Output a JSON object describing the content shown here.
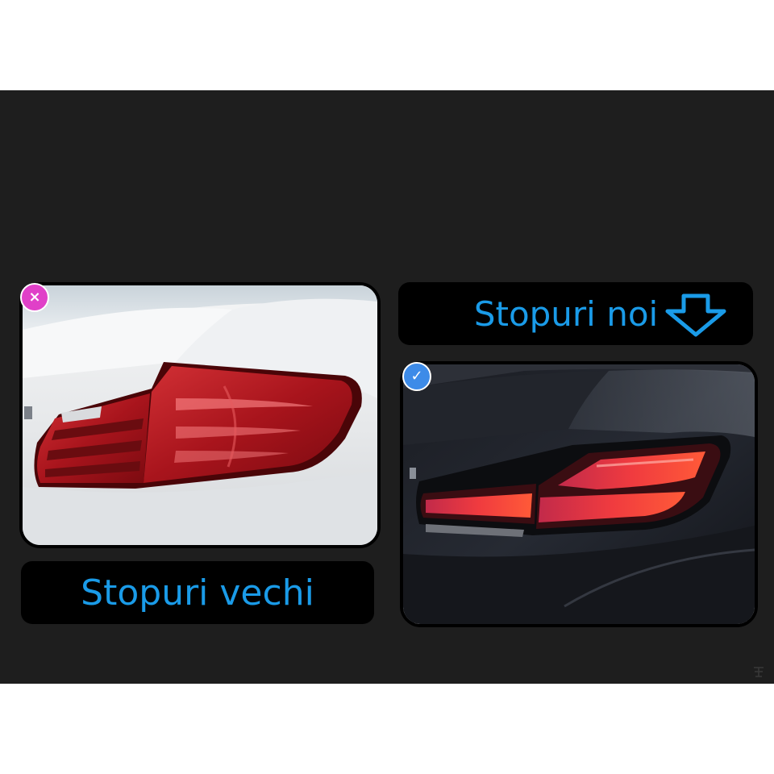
{
  "labels": {
    "old": "Stopuri vechi",
    "new": "Stopuri noi"
  },
  "badges": {
    "old_symbol": "×",
    "new_symbol": "✓"
  },
  "icons": [
    "close-icon",
    "check-icon",
    "down-arrow-icon"
  ],
  "colors": {
    "background": "#1e1e1e",
    "label_text": "#1a9be8",
    "label_box": "#000000",
    "badge_old": "#e040c8",
    "badge_new": "#3d8be8"
  }
}
